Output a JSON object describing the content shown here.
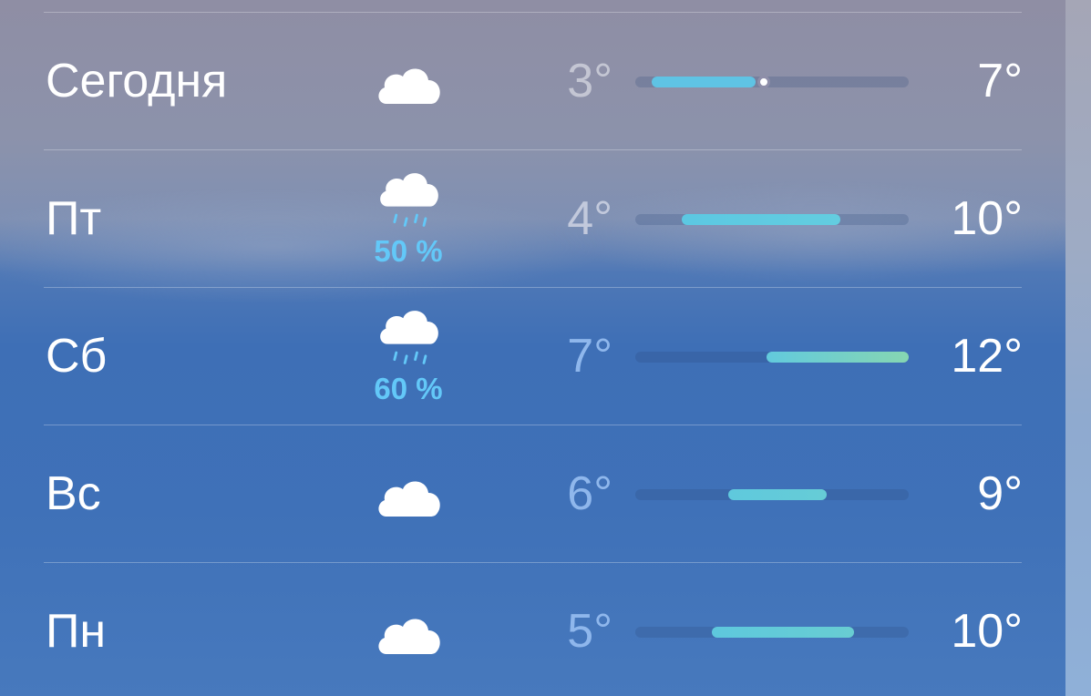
{
  "forecast": [
    {
      "day": "Сегодня",
      "icon": "cloud-icon",
      "precip": "",
      "low": "3°",
      "high": "7°",
      "low_color": "#c4c6d3",
      "bar_start": 0.06,
      "bar_end": 0.44,
      "bar_colors": [
        "#5fc3e4",
        "#5fc3e4"
      ],
      "current_marker": 0.47
    },
    {
      "day": "Пт",
      "icon": "cloud-rain-icon",
      "precip": "50 %",
      "low": "4°",
      "high": "10°",
      "low_color": "#c2c9dc",
      "bar_start": 0.17,
      "bar_end": 0.75,
      "bar_colors": [
        "#5cc8e2",
        "#63cde0"
      ],
      "current_marker": null
    },
    {
      "day": "Сб",
      "icon": "cloud-rain-icon",
      "precip": "60 %",
      "low": "7°",
      "high": "12°",
      "low_color": "#8fb7ec",
      "bar_start": 0.48,
      "bar_end": 1.0,
      "bar_colors": [
        "#62cadd",
        "#86d6b2"
      ],
      "current_marker": null
    },
    {
      "day": "Вс",
      "icon": "cloud-icon",
      "precip": "",
      "low": "6°",
      "high": "9°",
      "low_color": "#8fb7ec",
      "bar_start": 0.34,
      "bar_end": 0.7,
      "bar_colors": [
        "#5fc9dd",
        "#66ccd6"
      ],
      "current_marker": null
    },
    {
      "day": "Пн",
      "icon": "cloud-icon",
      "precip": "",
      "low": "5°",
      "high": "10°",
      "low_color": "#8fb7ec",
      "bar_start": 0.28,
      "bar_end": 0.8,
      "bar_colors": [
        "#5ec8dd",
        "#68cdd2"
      ],
      "current_marker": null
    }
  ],
  "colors": {
    "text_primary": "#ffffff",
    "precip_text": "#63c8f8",
    "icon_fill": "#ffffff",
    "rain_drops": "#63c8f8"
  }
}
